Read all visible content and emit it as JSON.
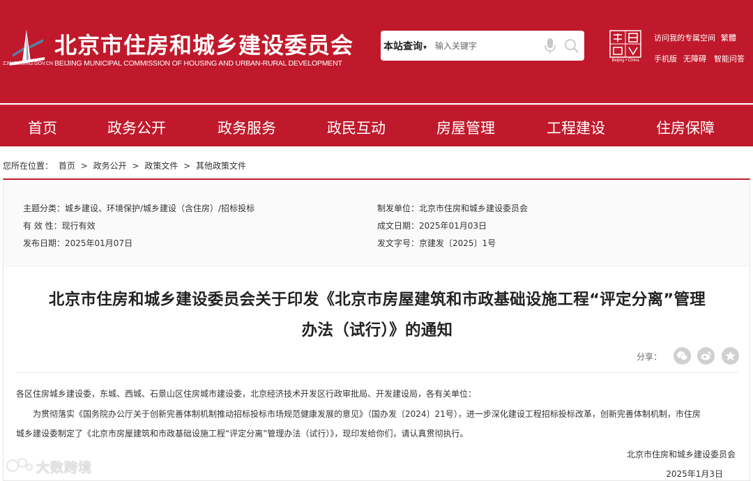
{
  "header": {
    "logo_url_text": "ZJW.BEIJING.GOV.CN",
    "title": "北京市住房和城乡建设委员会",
    "subtitle": "BEIJING MUNICIPAL COMMISSION OF HOUSING AND URBAN-RURAL DEVELOPMENT",
    "search": {
      "scope_label": "本站查询",
      "placeholder": "输入关键字"
    },
    "capital_badge_text": "Beijing • China",
    "links": [
      "访问我的专属空间",
      "繁體",
      "手机版",
      "无障碍",
      "智能问答"
    ]
  },
  "nav": {
    "items": [
      "首页",
      "政务公开",
      "政务服务",
      "政民互动",
      "房屋管理",
      "工程建设",
      "住房保障"
    ]
  },
  "breadcrumb": {
    "prefix": "您所在位置：",
    "items": [
      "首页",
      "政务公开",
      "政策文件",
      "其他政策文件"
    ],
    "separator": ">"
  },
  "meta": {
    "topic": "主题分类：城乡建设、环境保护/城乡建设（含住房）/招标投标",
    "validity": "有 效 性：现行有效",
    "publish_date": "发布日期：2025年01月07日",
    "issuer": "制发单位：北京市住房和城乡建设委员会",
    "created_date": "成文日期：2025年01月03日",
    "doc_number": "发文字号：京建发〔2025〕1号"
  },
  "document": {
    "title_line1": "北京市住房和城乡建设委员会关于印发《北京市房屋建筑和市政基础设施工程“评定分离”管理",
    "title_line2": "办法（试行）》的通知",
    "share_label": "分享：",
    "addressee": "各区住房城乡建设委，东城、西城、石景山区住房城市建设委，北京经济技术开发区行政审批局、开发建设局，各有关单位：",
    "para1_line1": "为贯彻落实《国务院办公厅关于创新完善体制机制推动招标投标市场规范健康发展的意见》（国办发〔2024〕21号），进一步深化建设工程招标投标改革，创新完善体制机制，市住房",
    "para1_line2": "城乡建设委制定了《北京市房屋建筑和市政基础设施工程“评定分离”管理办法（试行）》，现印发给你们，请认真贯彻执行。",
    "signature": "北京市住房和城乡建设委员会",
    "sign_date": "2025年1月3日"
  },
  "watermark": {
    "text": "大数跨境"
  },
  "colors": {
    "brand_red": "#c0192b"
  }
}
